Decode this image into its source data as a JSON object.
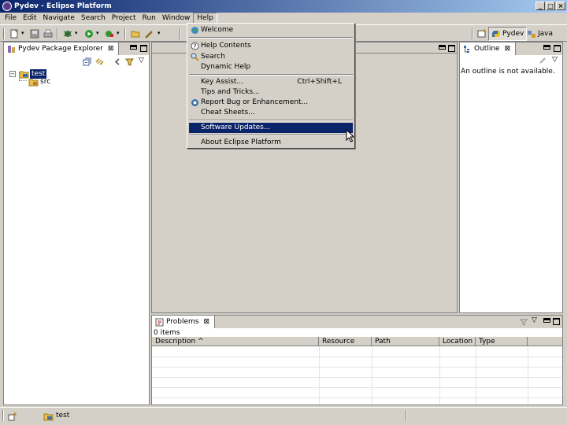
{
  "window": {
    "title": "Pydev - Eclipse Platform",
    "controls": [
      "_",
      "□",
      "×"
    ]
  },
  "menubar": {
    "items": [
      "File",
      "Edit",
      "Navigate",
      "Search",
      "Project",
      "Run",
      "Window",
      "Help"
    ],
    "active": "Help"
  },
  "toolbar": {
    "perspectives": [
      {
        "label": "Pydev",
        "active": true
      },
      {
        "label": "Java",
        "active": false
      }
    ]
  },
  "package_explorer": {
    "tab_label": "Pydev Package Explorer",
    "tree": [
      {
        "label": "test",
        "selected": true,
        "expanded": true,
        "children": [
          {
            "label": "src"
          }
        ]
      }
    ]
  },
  "outline": {
    "tab_label": "Outline",
    "message": "An outline is not available."
  },
  "problems": {
    "tab_label": "Problems",
    "count_text": "0 items",
    "columns": [
      "Description",
      "Resource",
      "Path",
      "Location",
      "Type"
    ]
  },
  "statusbar": {
    "item_label": "test"
  },
  "help_menu": {
    "items": [
      {
        "label": "Welcome",
        "icon": "welcome-icon"
      },
      {
        "sep": true
      },
      {
        "label": "Help Contents",
        "icon": "help-icon"
      },
      {
        "label": "Search",
        "icon": "search-icon"
      },
      {
        "label": "Dynamic Help"
      },
      {
        "sep": true
      },
      {
        "label": "Key Assist...",
        "accel": "Ctrl+Shift+L"
      },
      {
        "label": "Tips and Tricks..."
      },
      {
        "label": "Report Bug or Enhancement...",
        "icon": "bug-icon"
      },
      {
        "label": "Cheat Sheets..."
      },
      {
        "sep": true
      },
      {
        "label": "Software Updates...",
        "highlighted": true
      },
      {
        "sep": true
      },
      {
        "label": "About Eclipse Platform"
      }
    ]
  },
  "colors": {
    "selection": "#0a246a",
    "chrome": "#d4d0c8"
  }
}
